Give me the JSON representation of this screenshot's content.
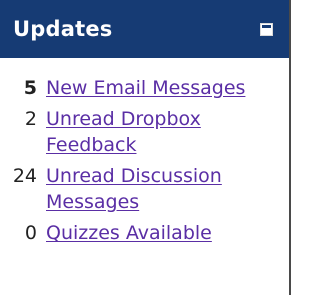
{
  "header": {
    "title": "Updates",
    "collapse_icon": "minimize-icon"
  },
  "items": [
    {
      "count": "5",
      "label": "New Email Messages"
    },
    {
      "count": "2",
      "label": "Unread Dropbox Feedback"
    },
    {
      "count": "24",
      "label": "Unread Discussion Messages"
    },
    {
      "count": "0",
      "label": "Quizzes Available"
    }
  ],
  "colors": {
    "header_bg": "#163b74",
    "link": "#5a2ea5",
    "text": "#222222"
  }
}
